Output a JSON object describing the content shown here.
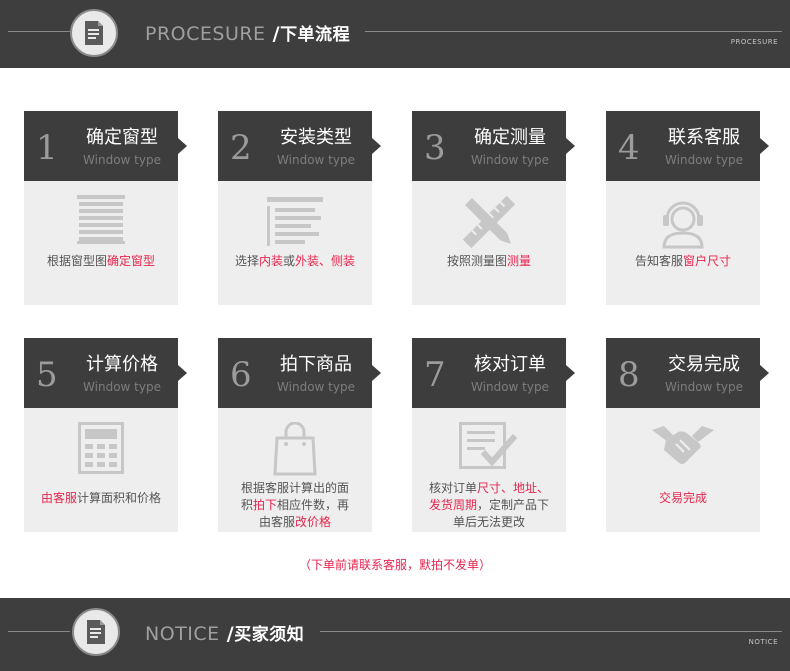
{
  "header": {
    "title_en": "PROCESURE",
    "separator": " /",
    "title_cn": "下单流程",
    "corner": "PROCESURE"
  },
  "footer": {
    "title_en": "NOTICE",
    "separator": " /",
    "title_cn": "买家须知",
    "corner": "NOTICE"
  },
  "steps": [
    {
      "num": "1",
      "title": "确定窗型",
      "subtitle": "Window type",
      "icon": "blinds-icon",
      "desc": [
        {
          "lines": [
            [
              {
                "t": "根据窗型图"
              },
              {
                "t": "确定窗型",
                "hl": true
              }
            ]
          ]
        }
      ]
    },
    {
      "num": "2",
      "title": "安装类型",
      "subtitle": "Window type",
      "icon": "list-icon",
      "desc": [
        {
          "lines": [
            [
              {
                "t": "选择"
              },
              {
                "t": "内装",
                "hl": true
              },
              {
                "t": "或"
              },
              {
                "t": "外装、侧装",
                "hl": true
              }
            ]
          ]
        }
      ]
    },
    {
      "num": "3",
      "title": "确定测量",
      "subtitle": "Window type",
      "icon": "ruler-pencil-icon",
      "desc": [
        {
          "lines": [
            [
              {
                "t": "按照测量图"
              },
              {
                "t": "测量",
                "hl": true
              }
            ]
          ]
        }
      ]
    },
    {
      "num": "4",
      "title": "联系客服",
      "subtitle": "Window type",
      "icon": "headset-icon",
      "desc": [
        {
          "lines": [
            [
              {
                "t": "告知客服"
              },
              {
                "t": "窗户尺寸",
                "hl": true
              }
            ]
          ]
        }
      ]
    },
    {
      "num": "5",
      "title": "计算价格",
      "subtitle": "Window type",
      "icon": "calculator-icon",
      "desc": [
        {
          "lines": [
            [
              {
                "t": "由客服",
                "hl": true
              },
              {
                "t": "计算面积和价格"
              }
            ]
          ]
        }
      ]
    },
    {
      "num": "6",
      "title": "拍下商品",
      "subtitle": "Window type",
      "icon": "shopping-bag-icon",
      "desc": [
        {
          "lines": [
            [
              {
                "t": "根据客服计算出的面"
              }
            ],
            [
              {
                "t": "积"
              },
              {
                "t": "拍下",
                "hl": true
              },
              {
                "t": "相应件数，再"
              }
            ],
            [
              {
                "t": "由客服"
              },
              {
                "t": "改价格",
                "hl": true
              }
            ]
          ]
        }
      ]
    },
    {
      "num": "7",
      "title": "核对订单",
      "subtitle": "Window type",
      "icon": "checklist-icon",
      "desc": [
        {
          "lines": [
            [
              {
                "t": "核对订单"
              },
              {
                "t": "尺寸、地址、",
                "hl": true
              }
            ],
            [
              {
                "t": "发货周期",
                "hl": true
              },
              {
                "t": "，定制产品下"
              }
            ],
            [
              {
                "t": "单后无法更改"
              }
            ]
          ]
        }
      ]
    },
    {
      "num": "8",
      "title": "交易完成",
      "subtitle": "Window type",
      "icon": "handshake-icon",
      "desc": [
        {
          "lines": [
            [
              {
                "t": "交易完成",
                "hl": true
              }
            ]
          ]
        }
      ]
    }
  ],
  "notice": "（下单前请联系客服，默拍不发单）",
  "colors": {
    "dark": "#3d3d3d",
    "panel": "#eeeeee",
    "accent": "#e8264e"
  }
}
